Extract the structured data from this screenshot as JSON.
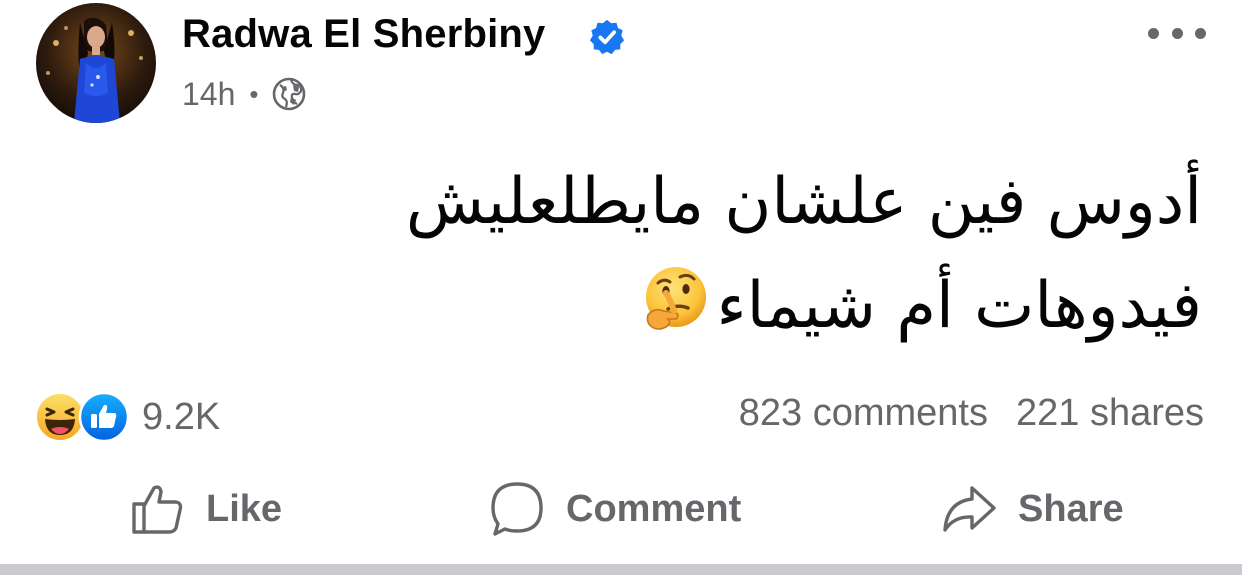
{
  "author": {
    "name": "Radwa El Sherbiny",
    "verified": true,
    "avatar_icon": "profile-photo",
    "time": "14h",
    "audience_icon": "globe-icon"
  },
  "post": {
    "text_line1": "أدوس فين علشان مايطلعليش",
    "text_line2": "فيدوهات أم شيماء",
    "emoji": "thinking-face"
  },
  "reactions": {
    "types": [
      "haha",
      "like"
    ],
    "count": "9.2K",
    "comments": "823 comments",
    "shares": "221 shares"
  },
  "actions": {
    "like": "Like",
    "comment": "Comment",
    "share": "Share"
  },
  "colors": {
    "text": "#050505",
    "secondary": "#65676b",
    "verified_blue": "#1877f2",
    "like_blue": "#1877f2",
    "haha_yellow": "#f7b125"
  }
}
